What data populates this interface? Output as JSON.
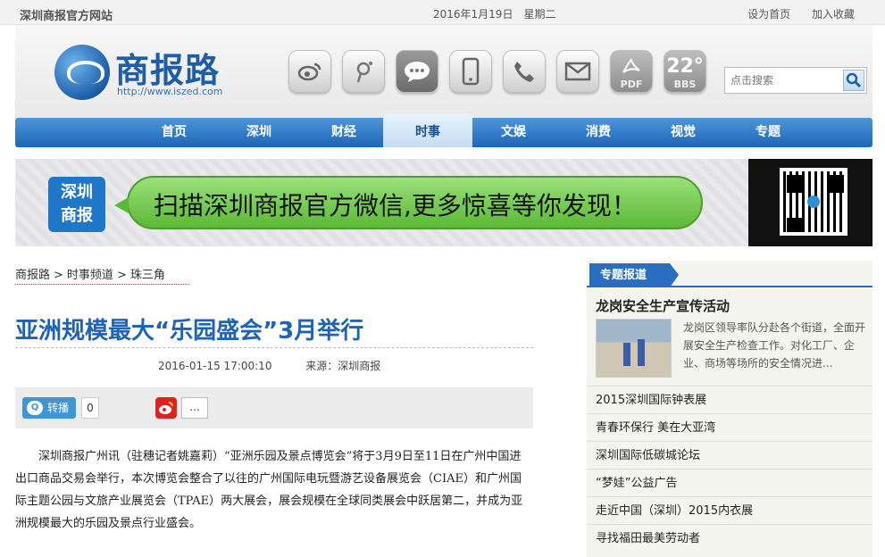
{
  "topbar": {
    "site_name": "深圳商报官方网站",
    "date": "2016年1月19日　星期二",
    "set_home": "设为首页",
    "bookmark": "加入收藏"
  },
  "logo": {
    "name": "商报路",
    "url": "http://www.iszed.com"
  },
  "header_icons": [
    {
      "icon": "weibo-icon"
    },
    {
      "icon": "tencent-weibo-icon"
    },
    {
      "icon": "chat-icon"
    },
    {
      "icon": "mobile-icon"
    },
    {
      "icon": "phone-icon"
    },
    {
      "icon": "mail-icon"
    },
    {
      "icon": "pdf-icon",
      "label": "PDF"
    },
    {
      "icon": "weather-icon",
      "temp": "22°",
      "label": "BBS"
    }
  ],
  "search": {
    "placeholder": "点击搜索"
  },
  "nav": {
    "items": [
      "首页",
      "深圳",
      "财经",
      "时事",
      "文娱",
      "消费",
      "视觉",
      "专题"
    ],
    "active": "时事"
  },
  "banner": {
    "seal": "深圳商报",
    "text": "扫描深圳商报官方微信,更多惊喜等你发现！"
  },
  "breadcrumb": [
    "商报路",
    "时事频道",
    "珠三角"
  ],
  "article": {
    "title": "亚洲规模最大“乐园盛会”3月举行",
    "datetime": "2016-01-15 17:00:10",
    "source": "来源：深圳商报",
    "repost_label": "转播",
    "repost_count": "0",
    "more_label": "...",
    "body": "深圳商报广州讯（驻穗记者姚嘉莉）“亚洲乐园及景点博览会”将于3月9日至11日在广州中国进出口商品交易会举行，本次博览会整合了以往的广州国际电玩暨游艺设备展览会（CIAE）和广州国际主题公园与文旅产业展览会（TPAE）两大展会，展会规模在全球同类展会中跃居第二，并成为亚洲规模最大的乐园及景点行业盛会。"
  },
  "sidebar": {
    "tag": "专题报道",
    "featured_title": "龙岗安全生产宣传活动",
    "featured_desc": "龙岗区领导率队分赴各个街道，全面开展安全生产检查工作。对化工厂、企业、商场等场所的安全情况进...",
    "links": [
      "2015深圳国际钟表展",
      "青春环保行 美在大亚湾",
      "深圳国际低碳城论坛",
      "“梦娃”公益广告",
      "走近中国（深圳）2015内衣展",
      "寻找福田最美劳动者"
    ]
  }
}
